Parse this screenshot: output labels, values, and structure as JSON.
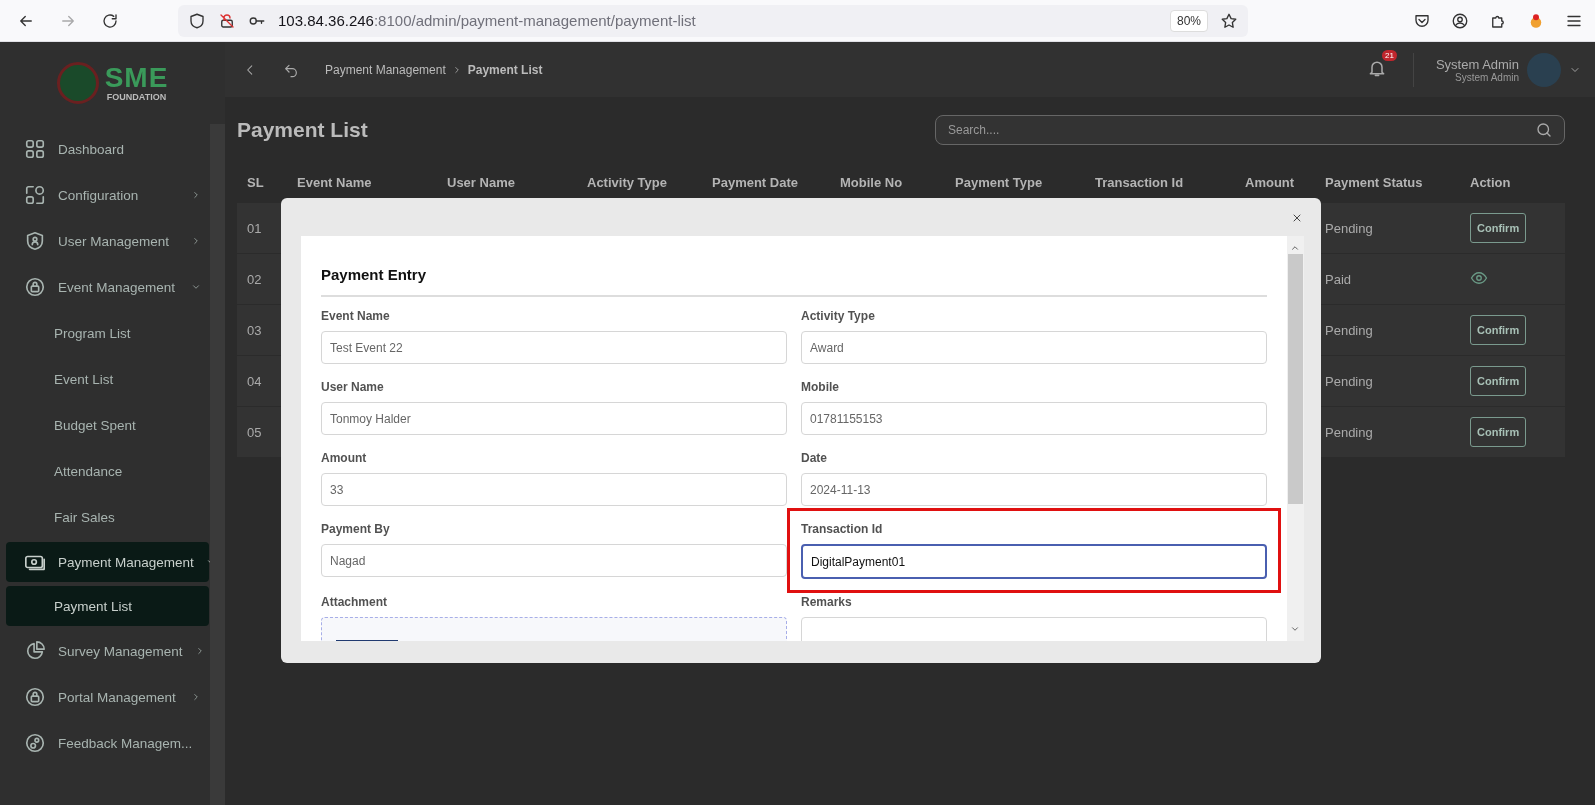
{
  "browser": {
    "url_host": "103.84.36.246",
    "url_path": ":8100/admin/payment-management/payment-list",
    "zoom": "80%"
  },
  "logo": {
    "mark": "SME",
    "sub": "FOUNDATION"
  },
  "header": {
    "breadcrumb": [
      "Payment Management",
      "Payment List"
    ],
    "notifications": "21",
    "user_name": "System Admin",
    "user_role": "System Admin"
  },
  "sidebar": {
    "items": [
      {
        "label": "Dashboard",
        "expandable": false,
        "expanded": false,
        "selected": false
      },
      {
        "label": "Configuration",
        "expandable": true,
        "expanded": false,
        "selected": false
      },
      {
        "label": "User Management",
        "expandable": true,
        "expanded": false,
        "selected": false
      },
      {
        "label": "Event Management",
        "expandable": true,
        "expanded": true,
        "selected": false,
        "children": [
          {
            "label": "Program List",
            "selected": false
          },
          {
            "label": "Event List",
            "selected": false
          },
          {
            "label": "Budget Spent",
            "selected": false
          },
          {
            "label": "Attendance",
            "selected": false
          },
          {
            "label": "Fair Sales",
            "selected": false
          }
        ]
      },
      {
        "label": "Payment Management",
        "expandable": true,
        "expanded": true,
        "selected": true,
        "children": [
          {
            "label": "Payment List",
            "selected": true
          }
        ]
      },
      {
        "label": "Survey Management",
        "expandable": true,
        "expanded": false,
        "selected": false
      },
      {
        "label": "Portal Management",
        "expandable": true,
        "expanded": false,
        "selected": false
      },
      {
        "label": "Feedback Managem...",
        "expandable": false,
        "expanded": false,
        "selected": false
      }
    ]
  },
  "page": {
    "title": "Payment List",
    "search_placeholder": "Search...."
  },
  "table": {
    "columns": [
      "SL",
      "Event Name",
      "User Name",
      "Activity Type",
      "Payment Date",
      "Mobile No",
      "Payment Type",
      "Transaction Id",
      "Amount",
      "Payment Status",
      "Action"
    ],
    "rows": [
      {
        "sl": "01",
        "payment_status": "Pending",
        "action": {
          "kind": "confirm",
          "label": "Confirm"
        }
      },
      {
        "sl": "02",
        "payment_status": "Paid",
        "action": {
          "kind": "view"
        }
      },
      {
        "sl": "03",
        "payment_status": "Pending",
        "action": {
          "kind": "confirm",
          "label": "Confirm"
        }
      },
      {
        "sl": "04",
        "payment_status": "Pending",
        "action": {
          "kind": "confirm",
          "label": "Confirm"
        }
      },
      {
        "sl": "05",
        "payment_status": "Pending",
        "action": {
          "kind": "confirm",
          "label": "Confirm"
        }
      }
    ]
  },
  "modal": {
    "title": "Payment Entry",
    "fields": [
      {
        "label": "Event Name",
        "value": "Test Event 22",
        "focused": false,
        "highlighted": false
      },
      {
        "label": "Activity Type",
        "value": "Award",
        "focused": false,
        "highlighted": false
      },
      {
        "label": "User Name",
        "value": "Tonmoy Halder",
        "focused": false,
        "highlighted": false
      },
      {
        "label": "Mobile",
        "value": "01781155153",
        "focused": false,
        "highlighted": false
      },
      {
        "label": "Amount",
        "value": "33",
        "focused": false,
        "highlighted": false
      },
      {
        "label": "Date",
        "value": "2024-11-13",
        "focused": false,
        "highlighted": false
      },
      {
        "label": "Payment By",
        "value": "Nagad",
        "focused": false,
        "highlighted": false
      },
      {
        "label": "Transaction Id",
        "value": "DigitalPayment01",
        "focused": true,
        "highlighted": true
      }
    ],
    "attachment_label": "Attachment",
    "remarks_label": "Remarks"
  }
}
